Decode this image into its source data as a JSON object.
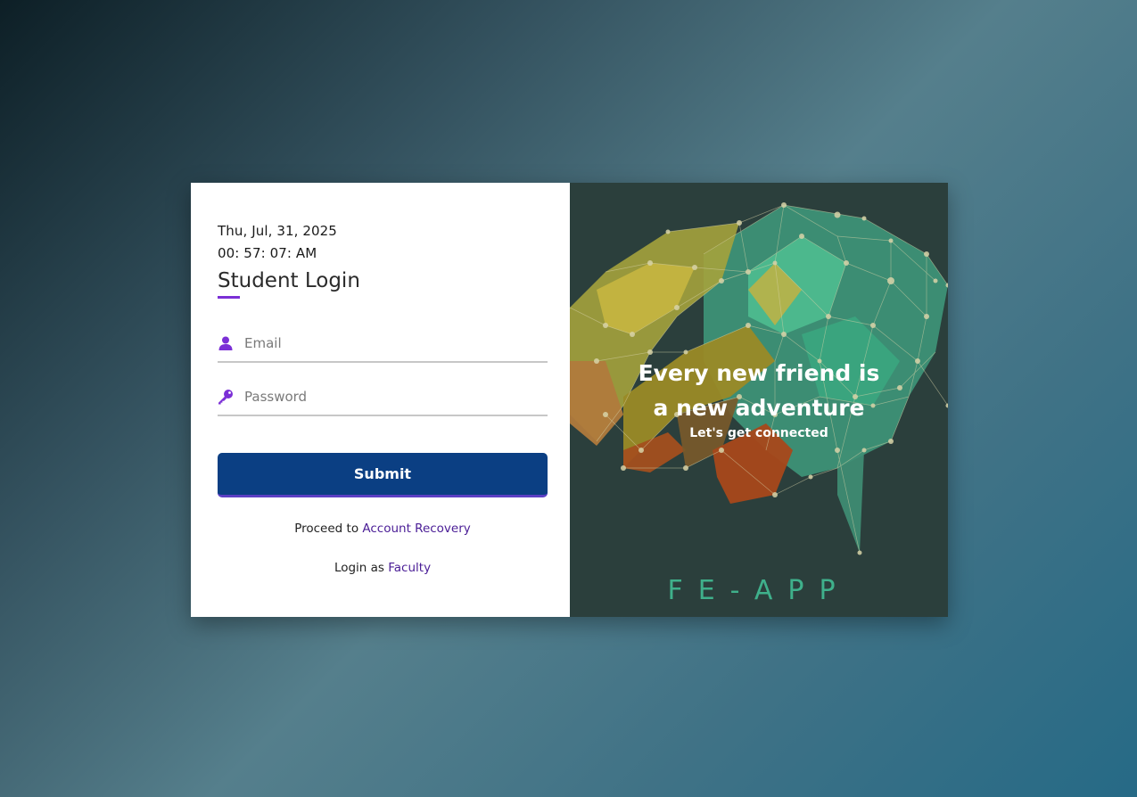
{
  "login": {
    "date": "Thu, Jul, 31, 2025",
    "time": "00: 57: 07: AM",
    "title": "Student Login",
    "email_placeholder": "Email",
    "password_placeholder": "Password",
    "submit_label": "Submit",
    "recovery_prefix": "Proceed to ",
    "recovery_link": "Account Recovery",
    "faculty_prefix": "Login as ",
    "faculty_link": "Faculty"
  },
  "banner": {
    "headline": "Every new friend is a new adventure",
    "subline": "Let's get connected",
    "brand": "FE-APP"
  },
  "colors": {
    "accent": "#7b2fd6",
    "submit": "#0b3f83",
    "link": "#4a1d96",
    "banner_bg": "#2b3f3c",
    "brand": "#3fb08b"
  }
}
